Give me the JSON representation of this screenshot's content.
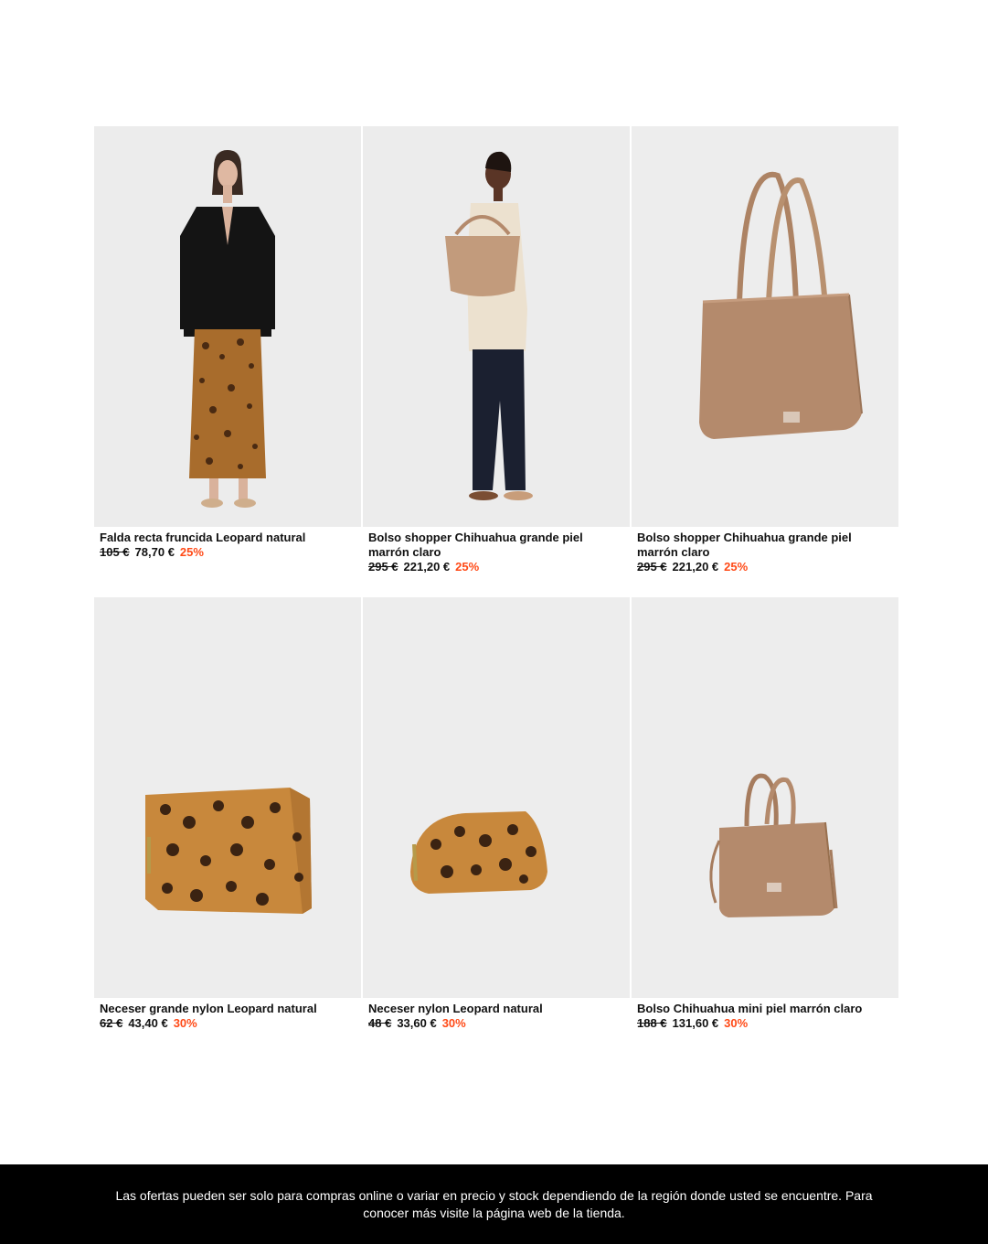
{
  "products": [
    {
      "title": "Falda recta fruncida Leopard natural",
      "old_price": "105 €",
      "price": "78,70 €",
      "discount": "25%",
      "image_icon": "model-blazer-leopard-skirt-image"
    },
    {
      "title": "Bolso shopper Chihuahua grande piel marrón claro",
      "old_price": "295 €",
      "price": "221,20 €",
      "discount": "25%",
      "image_icon": "model-with-shopper-bag-image"
    },
    {
      "title": "Bolso shopper Chihuahua grande piel marrón claro",
      "old_price": "295 €",
      "price": "221,20 €",
      "discount": "25%",
      "image_icon": "shopper-bag-image"
    },
    {
      "title": "Neceser grande nylon Leopard natural",
      "old_price": "62 €",
      "price": "43,40 €",
      "discount": "30%",
      "image_icon": "leopard-toiletry-bag-large-image"
    },
    {
      "title": "Neceser nylon Leopard natural",
      "old_price": "48 €",
      "price": "33,60 €",
      "discount": "30%",
      "image_icon": "leopard-toiletry-bag-image"
    },
    {
      "title": "Bolso Chihuahua mini piel marrón claro",
      "old_price": "188 €",
      "price": "131,60 €",
      "discount": "30%",
      "image_icon": "mini-bag-image"
    }
  ],
  "footer": {
    "note": "Las ofertas pueden ser solo para compras online o variar en precio y stock dependiendo de la región donde usted se encuentre. Para conocer más visite la página web de la tienda."
  },
  "colors": {
    "discount": "#ff4a17",
    "footer_bg": "#000000",
    "leather": "#b48a6c"
  }
}
